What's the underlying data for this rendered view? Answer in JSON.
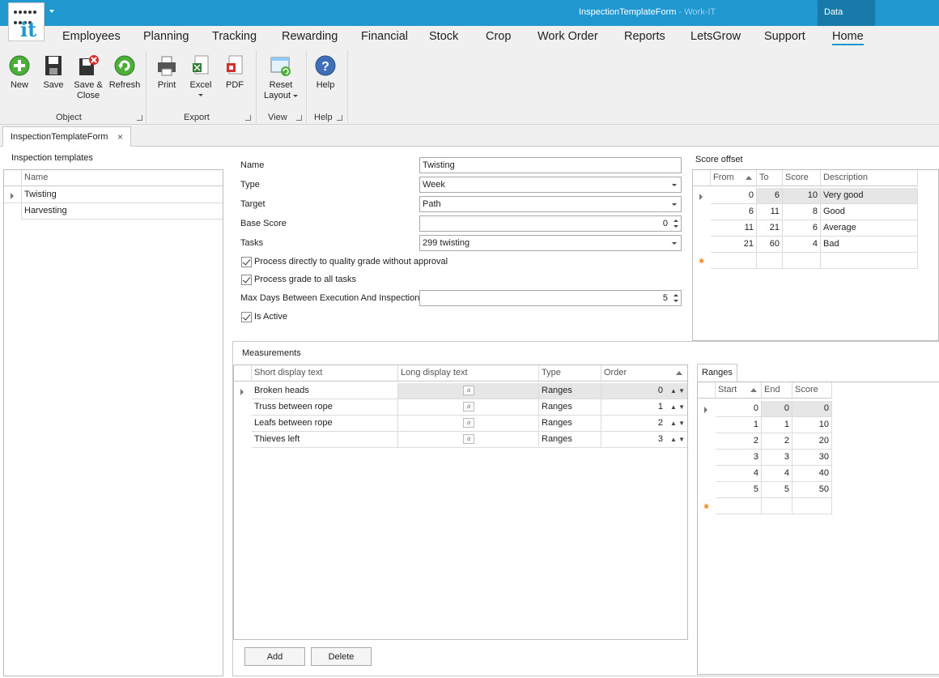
{
  "window": {
    "title": "InspectionTemplateForm",
    "title_sep": " - ",
    "app_name": "Work-IT",
    "data_tab": "Data",
    "logo_text": "it"
  },
  "menu": [
    "Employees",
    "Planning",
    "Tracking",
    "Rewarding",
    "Financial",
    "Stock",
    "Crop",
    "Work Order",
    "Reports",
    "LetsGrow",
    "Support",
    "Home"
  ],
  "ribbon": {
    "object": {
      "label": "Object",
      "new": "New",
      "save": "Save",
      "save_close_1": "Save &",
      "save_close_2": "Close",
      "refresh": "Refresh"
    },
    "export": {
      "label": "Export",
      "print": "Print",
      "excel": "Excel",
      "pdf": "PDF"
    },
    "view": {
      "label": "View",
      "reset_1": "Reset",
      "reset_2": "Layout"
    },
    "help": {
      "label": "Help",
      "help": "Help"
    }
  },
  "doc_tab": {
    "label": "InspectionTemplateForm",
    "close": "×"
  },
  "templates": {
    "title": "Inspection templates",
    "header": "Name",
    "rows": [
      "Twisting",
      "Harvesting"
    ]
  },
  "form": {
    "name_label": "Name",
    "name_value": "Twisting",
    "type_label": "Type",
    "type_value": "Week",
    "target_label": "Target",
    "target_value": "Path",
    "base_score_label": "Base Score",
    "base_score_value": "0",
    "tasks_label": "Tasks",
    "tasks_value": "299 twisting",
    "process_direct": "Process directly to quality grade without approval",
    "process_all": "Process grade to all tasks",
    "max_days_label": "Max Days Between Execution And Inspection",
    "max_days_value": "5",
    "is_active": "Is Active"
  },
  "score_offset": {
    "title": "Score offset",
    "headers": [
      "From",
      "To",
      "Score",
      "Description"
    ],
    "rows": [
      [
        "0",
        "6",
        "10",
        "Very good"
      ],
      [
        "6",
        "11",
        "8",
        "Good"
      ],
      [
        "11",
        "21",
        "6",
        "Average"
      ],
      [
        "21",
        "60",
        "4",
        "Bad"
      ]
    ],
    "new_row": "✷"
  },
  "measurements": {
    "title": "Measurements",
    "headers": [
      "Short display text",
      "Long display text",
      "Type",
      "Order"
    ],
    "rows": [
      [
        "Broken heads",
        "a",
        "Ranges",
        "0"
      ],
      [
        "Truss between rope",
        "a",
        "Ranges",
        "1"
      ],
      [
        "Leafs between rope",
        "a",
        "Ranges",
        "2"
      ],
      [
        "Thieves left",
        "a",
        "Ranges",
        "3"
      ]
    ],
    "add": "Add",
    "delete": "Delete"
  },
  "ranges": {
    "tab": "Ranges",
    "headers": [
      "Start",
      "End",
      "Score"
    ],
    "rows": [
      [
        "0",
        "0",
        "0"
      ],
      [
        "1",
        "1",
        "10"
      ],
      [
        "2",
        "2",
        "20"
      ],
      [
        "3",
        "3",
        "30"
      ],
      [
        "4",
        "4",
        "40"
      ],
      [
        "5",
        "5",
        "50"
      ]
    ],
    "new_row": "✷"
  },
  "colors": {
    "accent": "#1f97cf",
    "data_tab": "#177aa8",
    "new_row": "#f08a24"
  }
}
